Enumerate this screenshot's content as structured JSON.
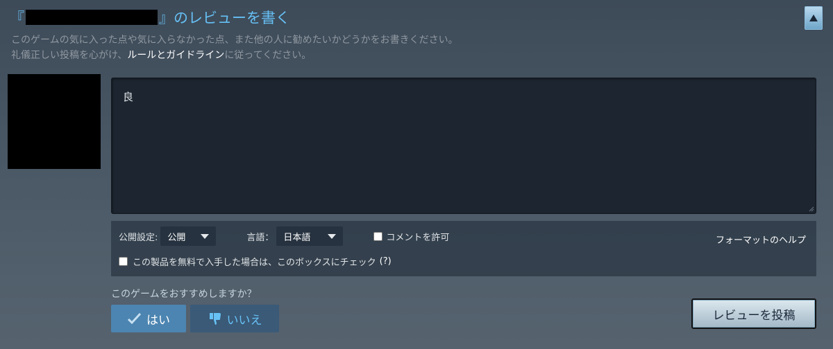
{
  "header": {
    "title_open": "『",
    "title_close": "』のレビューを書く"
  },
  "description": {
    "line1": "このゲームの気に入った点や気に入らなかった点、また他の人に勧めたいかどうかをお書きください。",
    "line2_pre": "礼儀正しい投稿を心がけ、",
    "line2_link": "ルールとガイドライン",
    "line2_post": "に従ってください。"
  },
  "review": {
    "text": "良"
  },
  "options": {
    "visibility_label": "公開設定:",
    "visibility_value": "公開",
    "language_label": "言語：",
    "language_value": "日本語",
    "allow_comments_label": "コメントを許可",
    "free_copy_label": "この製品を無料で入手した場合は、このボックスにチェック",
    "free_copy_help": "(?)",
    "format_help": "フォーマットのヘルプ"
  },
  "recommend": {
    "question": "このゲームをおすすめしますか？",
    "yes_label": "はい",
    "no_label": "いいえ"
  },
  "submit": {
    "label": "レビューを投稿"
  },
  "icons": {
    "collapse": "triangle-up-icon",
    "yes": "thumbs-up-icon",
    "no": "thumbs-down-icon",
    "caret": "caret-down-icon"
  },
  "colors": {
    "accent": "#66c0f4",
    "yes_button": "#4c85b1",
    "no_button": "#3a5a78"
  }
}
